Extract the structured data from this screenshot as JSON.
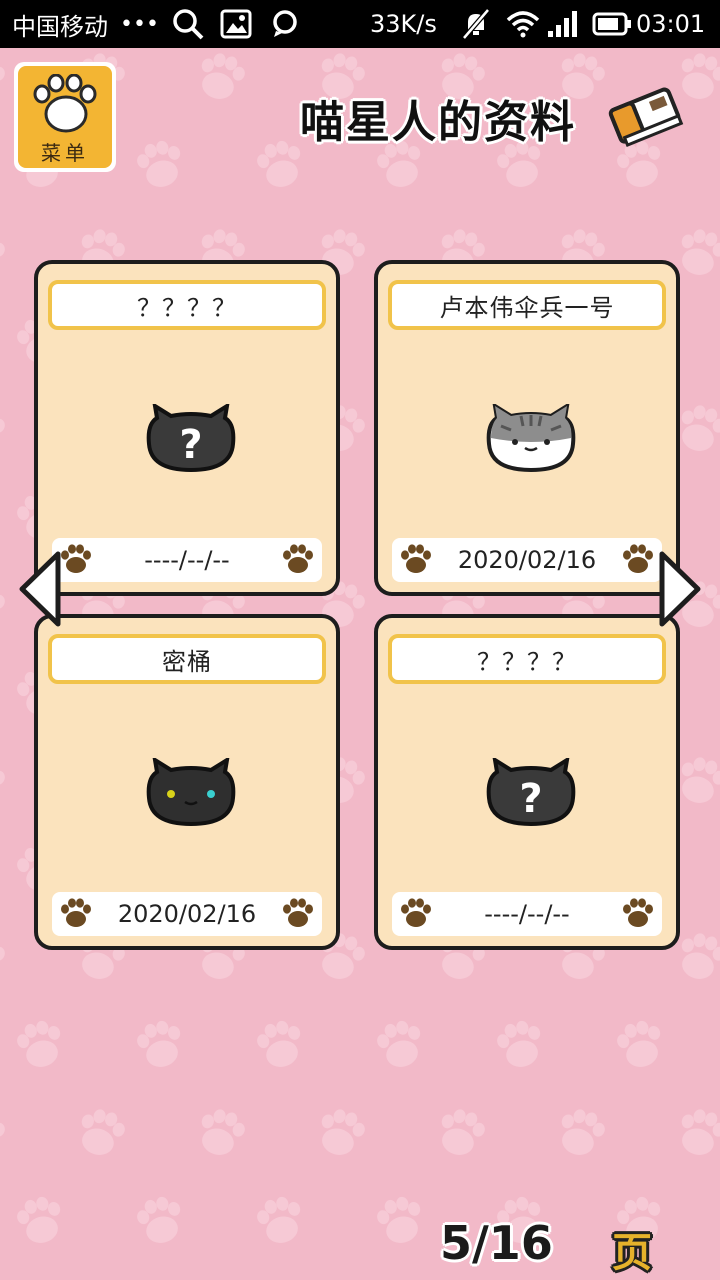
{
  "status_bar": {
    "carrier": "中国移动",
    "dots": "•••",
    "speed": "33K/s",
    "time": "03:01",
    "icons": [
      "search-icon",
      "image-icon",
      "chat-icon",
      "mute-icon",
      "wifi-icon",
      "signal-icon",
      "battery-icon"
    ]
  },
  "header": {
    "menu_label": "菜单",
    "title": "喵星人的资料"
  },
  "cards": [
    {
      "name": "？？？？",
      "date": "----/--/--",
      "cat": "unknown-cat-icon"
    },
    {
      "name": "卢本伟伞兵一号",
      "date": "2020/02/16",
      "cat": "gray-tabby-cat-icon"
    },
    {
      "name": "密桶",
      "date": "2020/02/16",
      "cat": "black-cat-icon"
    },
    {
      "name": "？？？？",
      "date": "----/--/--",
      "cat": "unknown-cat-icon"
    }
  ],
  "pagination": {
    "current": "5/16",
    "suffix": "页"
  },
  "colors": {
    "background": "#f2b9c8",
    "card": "#fbe3bd",
    "name_border": "#f1c34a",
    "paw": "#6b4a22",
    "menu": "#f3b533"
  }
}
